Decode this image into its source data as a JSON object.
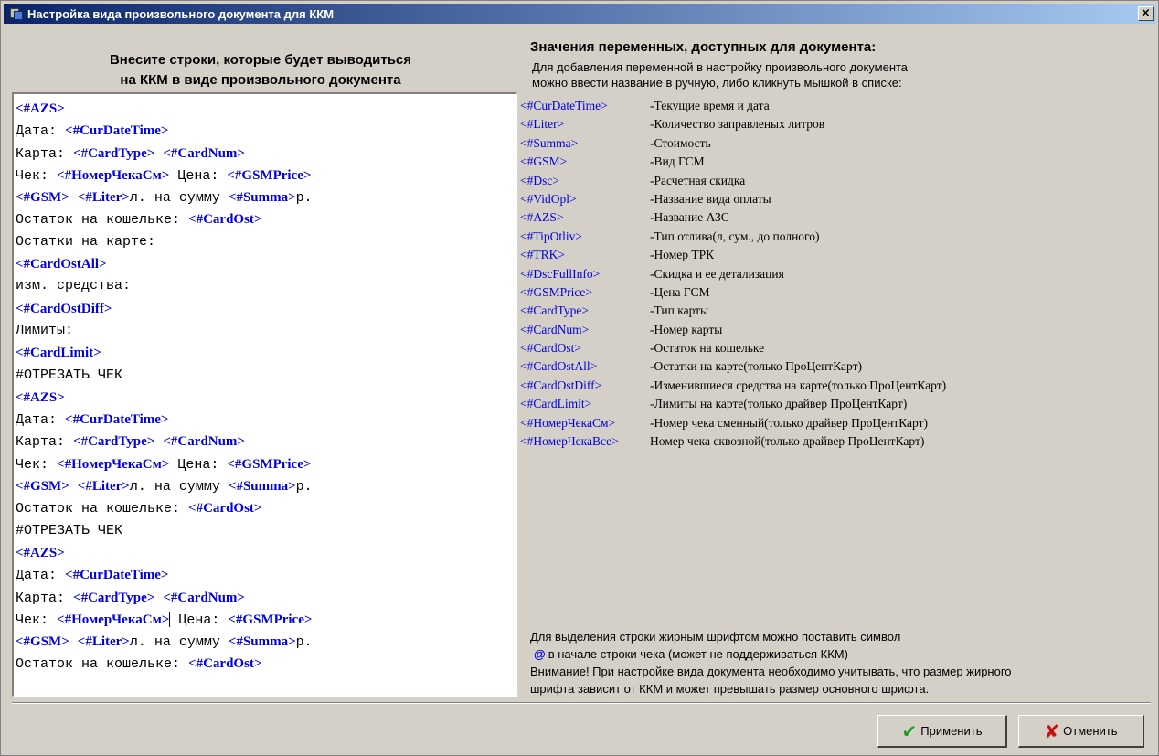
{
  "window": {
    "title": "Настройка вида произвольного документа для ККМ",
    "close_label": "×"
  },
  "left": {
    "heading_line1": "Внесите строки, которые будет выводиться",
    "heading_line2": "на ККМ в виде произвольного документа"
  },
  "editor_lines": [
    [
      {
        "t": "tag",
        "v": "<#AZS>"
      }
    ],
    [
      {
        "t": "txt",
        "v": "Дата: "
      },
      {
        "t": "tag",
        "v": "<#CurDateTime>"
      }
    ],
    [
      {
        "t": "txt",
        "v": "Карта: "
      },
      {
        "t": "tag",
        "v": "<#CardType>"
      },
      {
        "t": "txt",
        "v": " "
      },
      {
        "t": "tag",
        "v": "<#CardNum>"
      }
    ],
    [
      {
        "t": "txt",
        "v": "Чек: "
      },
      {
        "t": "tag",
        "v": "<#НомерЧекаСм>"
      },
      {
        "t": "txt",
        "v": " Цена: "
      },
      {
        "t": "tag",
        "v": "<#GSMPrice>"
      }
    ],
    [
      {
        "t": "tag",
        "v": "<#GSM>"
      },
      {
        "t": "txt",
        "v": " "
      },
      {
        "t": "tag",
        "v": "<#Liter>"
      },
      {
        "t": "txt",
        "v": "л. на сумму "
      },
      {
        "t": "tag",
        "v": "<#Summa>"
      },
      {
        "t": "txt",
        "v": "р."
      }
    ],
    [
      {
        "t": "txt",
        "v": "Остаток на кошельке: "
      },
      {
        "t": "tag",
        "v": "<#CardOst>"
      }
    ],
    [
      {
        "t": "txt",
        "v": "Остатки на карте:"
      }
    ],
    [
      {
        "t": "tag",
        "v": "<#CardOstAll>"
      }
    ],
    [
      {
        "t": "txt",
        "v": "изм. средства:"
      }
    ],
    [
      {
        "t": "tag",
        "v": "<#CardOstDiff>"
      }
    ],
    [
      {
        "t": "txt",
        "v": "Лимиты:"
      }
    ],
    [
      {
        "t": "tag",
        "v": "<#CardLimit>"
      }
    ],
    [
      {
        "t": "txt",
        "v": "#ОТРЕЗАТЬ ЧЕК"
      }
    ],
    [
      {
        "t": "tag",
        "v": "<#AZS>"
      }
    ],
    [
      {
        "t": "txt",
        "v": "Дата: "
      },
      {
        "t": "tag",
        "v": "<#CurDateTime>"
      }
    ],
    [
      {
        "t": "txt",
        "v": "Карта: "
      },
      {
        "t": "tag",
        "v": "<#CardType>"
      },
      {
        "t": "txt",
        "v": " "
      },
      {
        "t": "tag",
        "v": "<#CardNum>"
      }
    ],
    [
      {
        "t": "txt",
        "v": "Чек: "
      },
      {
        "t": "tag",
        "v": "<#НомерЧекаСм>"
      },
      {
        "t": "txt",
        "v": " Цена: "
      },
      {
        "t": "tag",
        "v": "<#GSMPrice>"
      }
    ],
    [
      {
        "t": "tag",
        "v": "<#GSM>"
      },
      {
        "t": "txt",
        "v": " "
      },
      {
        "t": "tag",
        "v": "<#Liter>"
      },
      {
        "t": "txt",
        "v": "л. на сумму "
      },
      {
        "t": "tag",
        "v": "<#Summa>"
      },
      {
        "t": "txt",
        "v": "р."
      }
    ],
    [
      {
        "t": "txt",
        "v": "Остаток на кошельке: "
      },
      {
        "t": "tag",
        "v": "<#CardOst>"
      }
    ],
    [
      {
        "t": "txt",
        "v": "#ОТРЕЗАТЬ ЧЕК"
      }
    ],
    [
      {
        "t": "tag",
        "v": "<#AZS>"
      }
    ],
    [
      {
        "t": "txt",
        "v": "Дата: "
      },
      {
        "t": "tag",
        "v": "<#CurDateTime>"
      }
    ],
    [
      {
        "t": "txt",
        "v": "Карта: "
      },
      {
        "t": "tag",
        "v": "<#CardType>"
      },
      {
        "t": "txt",
        "v": " "
      },
      {
        "t": "tag",
        "v": "<#CardNum>"
      }
    ],
    [
      {
        "t": "txt",
        "v": "Чек: "
      },
      {
        "t": "tag",
        "v": "<#НомерЧекаСм>"
      },
      {
        "t": "caret",
        "v": ""
      },
      {
        "t": "txt",
        "v": " Цена: "
      },
      {
        "t": "tag",
        "v": "<#GSMPrice>"
      }
    ],
    [
      {
        "t": "tag",
        "v": "<#GSM>"
      },
      {
        "t": "txt",
        "v": " "
      },
      {
        "t": "tag",
        "v": "<#Liter>"
      },
      {
        "t": "txt",
        "v": "л. на сумму "
      },
      {
        "t": "tag",
        "v": "<#Summa>"
      },
      {
        "t": "txt",
        "v": "р."
      }
    ],
    [
      {
        "t": "txt",
        "v": "Остаток на кошельке: "
      },
      {
        "t": "tag",
        "v": "<#CardOst>"
      }
    ]
  ],
  "right": {
    "heading": "Значения переменных, доступных для документа:",
    "sub_line1": "Для добавления переменной в настройку произвольного документа",
    "sub_line2": "можно ввести название в ручную, либо кликнуть мышкой в списке:"
  },
  "variables": [
    {
      "name": "<#CurDateTime>",
      "desc": "-Текущие время и дата"
    },
    {
      "name": "<#Liter>",
      "desc": "-Количество заправленых литров"
    },
    {
      "name": "<#Summa>",
      "desc": "-Стоимость"
    },
    {
      "name": "<#GSM>",
      "desc": "-Вид ГСМ"
    },
    {
      "name": "<#Dsc>",
      "desc": "-Расчетная скидка"
    },
    {
      "name": "<#VidOpl>",
      "desc": "-Название вида оплаты"
    },
    {
      "name": "<#AZS>",
      "desc": "-Название АЗС"
    },
    {
      "name": "<#TipOtliv>",
      "desc": "-Тип отлива(л, сум., до полного)"
    },
    {
      "name": "<#TRK>",
      "desc": "-Номер ТРК"
    },
    {
      "name": "<#DscFullInfo>",
      "desc": "-Скидка и ее детализация"
    },
    {
      "name": "<#GSMPrice>",
      "desc": "-Цена ГСМ"
    },
    {
      "name": "<#CardType>",
      "desc": "-Тип карты"
    },
    {
      "name": "<#CardNum>",
      "desc": "-Номер карты"
    },
    {
      "name": "<#CardOst>",
      "desc": "-Остаток на кошельке"
    },
    {
      "name": "<#CardOstAll>",
      "desc": "-Остатки на карте(только ПроЦентКарт)"
    },
    {
      "name": "<#CardOstDiff>",
      "desc": "-Изменившиеся средства на карте(только ПроЦентКарт)"
    },
    {
      "name": "<#CardLimit>",
      "desc": "-Лимиты на карте(только драйвер ПроЦентКарт)"
    },
    {
      "name": "<#НомерЧекаСм>",
      "desc": "-Номер чека сменный(только драйвер ПроЦентКарт)"
    },
    {
      "name": "<#НомерЧекаВсе>",
      "desc": "Номер чека сквозной(только драйвер ПроЦентКарт)"
    }
  ],
  "notes": {
    "line1": "Для выделения строки жирным шрифтом можно поставить символ",
    "at_symbol": "@",
    "line2": "в начале строки чека (может не поддерживаться ККМ)",
    "line3": "Внимание! При настройке вида документа необходимо учитывать, что размер жирного",
    "line4": "шрифта зависит от ККМ и может превышать размер основного шрифта."
  },
  "buttons": {
    "apply_label": "Применить",
    "cancel_label": "Отменить"
  },
  "icons": {
    "apply": "check-icon",
    "cancel": "cross-icon"
  },
  "colors": {
    "tag": "#0000e0",
    "title_bar": "#0a246a",
    "apply_icon": "#20a020",
    "cancel_icon": "#c81010"
  }
}
